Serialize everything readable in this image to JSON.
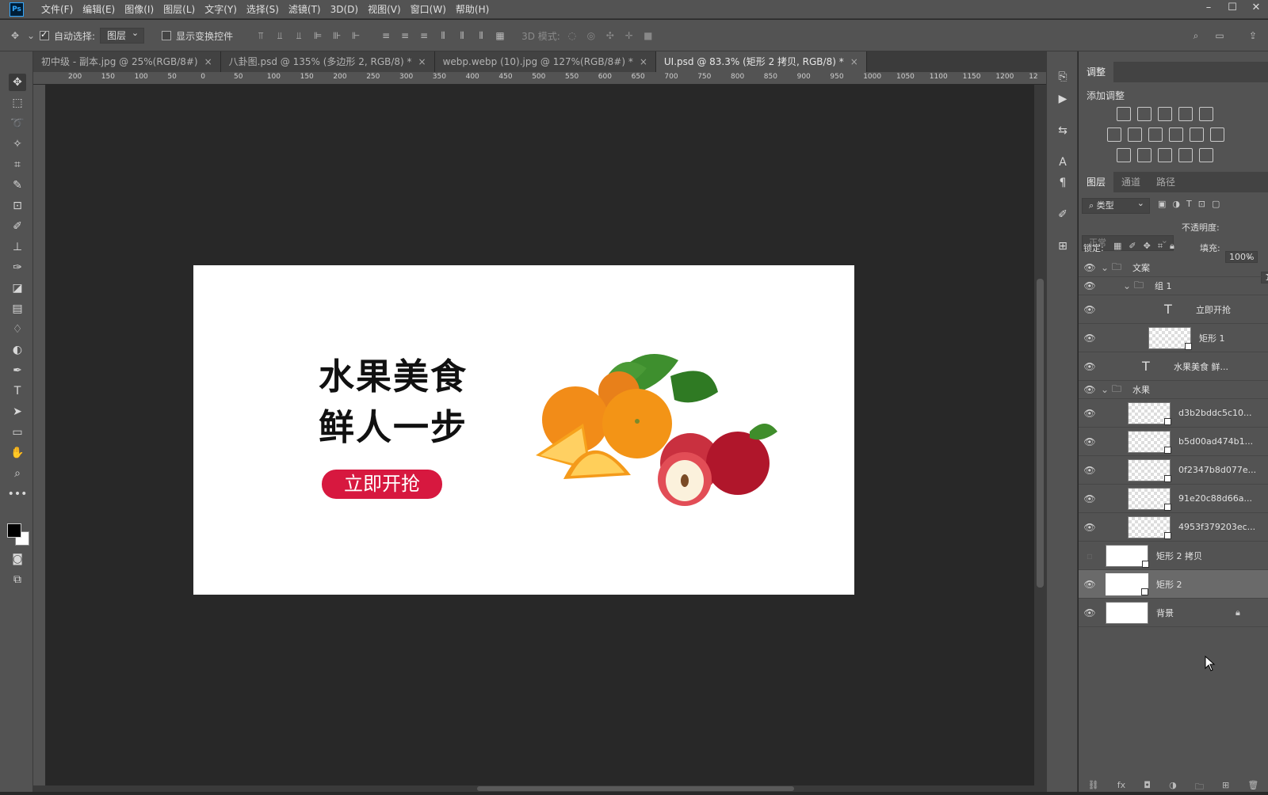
{
  "app": {
    "logo": "Ps"
  },
  "menu": [
    "文件(F)",
    "编辑(E)",
    "图像(I)",
    "图层(L)",
    "文字(Y)",
    "选择(S)",
    "滤镜(T)",
    "3D(D)",
    "视图(V)",
    "窗口(W)",
    "帮助(H)"
  ],
  "options": {
    "auto_select_label": "自动选择:",
    "auto_select_value": "图层",
    "show_transform_label": "显示变换控件",
    "mode_3d_label": "3D 模式:"
  },
  "tabs": [
    {
      "label": "初中级 - 副本.jpg @ 25%(RGB/8#)"
    },
    {
      "label": "八卦图.psd @ 135% (多边形 2, RGB/8) *"
    },
    {
      "label": "webp.webp (10).jpg @ 127%(RGB/8#) *"
    },
    {
      "label": "UI.psd @ 83.3% (矩形 2 拷贝, RGB/8) *"
    }
  ],
  "ruler_h": [
    "200",
    "150",
    "100",
    "50",
    "0",
    "50",
    "100",
    "150",
    "200",
    "250",
    "300",
    "350",
    "400",
    "450",
    "500",
    "550",
    "600",
    "650",
    "700",
    "750",
    "800",
    "850",
    "900",
    "950",
    "1000",
    "1050",
    "1100",
    "1150",
    "1200",
    "12"
  ],
  "doc": {
    "line1": "水果美食",
    "line2": "鲜人一步",
    "cta": "立即开抢",
    "colors": {
      "cta_bg": "#d7183f",
      "headline": "#111111"
    }
  },
  "adjust_panel": {
    "tab": "调整",
    "add_label": "添加调整"
  },
  "layers_panel": {
    "tabs": [
      "图层",
      "通道",
      "路径"
    ],
    "filter_kind": "类型",
    "blend_mode": "正常",
    "opacity_label": "不透明度:",
    "opacity_value": "100%",
    "lock_label": "锁定:",
    "fill_label": "填充:",
    "fill_value": "100%",
    "layers": [
      {
        "name": "文案",
        "kind": "group"
      },
      {
        "name": "组 1",
        "kind": "group"
      },
      {
        "name": "立即开抢",
        "kind": "text"
      },
      {
        "name": "矩形 1",
        "kind": "shape"
      },
      {
        "name": "水果美食 鲜...",
        "kind": "text"
      },
      {
        "name": "水果",
        "kind": "group"
      },
      {
        "name": "d3b2bddc5c10...",
        "kind": "smart"
      },
      {
        "name": "b5d00ad474b1...",
        "kind": "smart"
      },
      {
        "name": "0f2347b8d077e...",
        "kind": "smart"
      },
      {
        "name": "91e20c88d66a...",
        "kind": "smart"
      },
      {
        "name": "4953f379203ec...",
        "kind": "smart"
      },
      {
        "name": "矩形 2 拷贝",
        "kind": "shape"
      },
      {
        "name": "矩形 2",
        "kind": "shape"
      },
      {
        "name": "背景",
        "kind": "background"
      }
    ]
  }
}
